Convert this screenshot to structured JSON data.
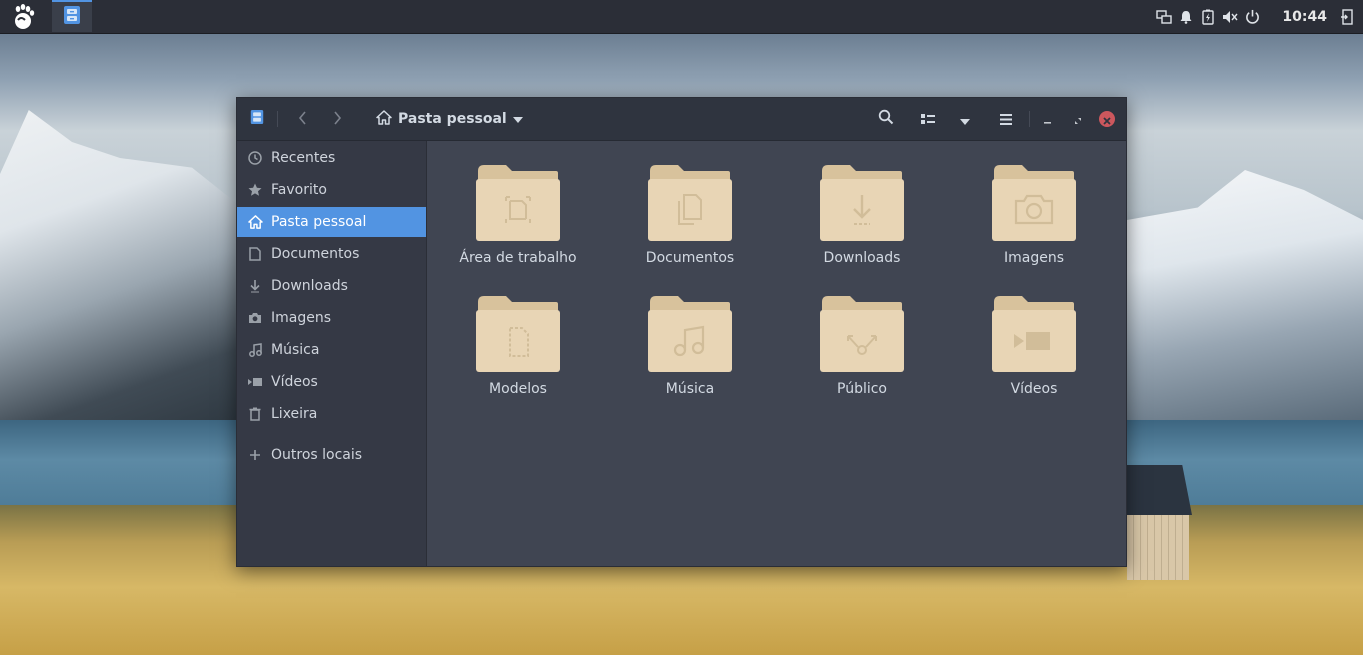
{
  "top_panel": {
    "clock": "10:44",
    "colors": {
      "panel_bg": "#2b2e37",
      "accent": "#5294e2"
    },
    "tray_icons": [
      "network-icon",
      "notifications-bell-icon",
      "battery-icon",
      "volume-muted-icon",
      "power-icon",
      "logout-icon"
    ]
  },
  "window": {
    "path_label": "Pasta pessoal",
    "colors": {
      "header_bg": "#2f343f",
      "sidebar_active": "#5294e2",
      "close": "#cc575d",
      "folder": "#e8d5b5"
    }
  },
  "sidebar": {
    "items": [
      {
        "label": "Recentes",
        "icon": "clock-icon"
      },
      {
        "label": "Favorito",
        "icon": "star-icon"
      },
      {
        "label": "Pasta pessoal",
        "icon": "home-icon",
        "active": true
      },
      {
        "label": "Documentos",
        "icon": "document-icon"
      },
      {
        "label": "Downloads",
        "icon": "download-icon"
      },
      {
        "label": "Imagens",
        "icon": "camera-icon"
      },
      {
        "label": "Música",
        "icon": "music-icon"
      },
      {
        "label": "Vídeos",
        "icon": "video-icon"
      },
      {
        "label": "Lixeira",
        "icon": "trash-icon"
      },
      {
        "label": "Outros locais",
        "icon": "plus-icon"
      }
    ]
  },
  "folders": [
    {
      "label": "Área de trabalho",
      "icon": "desktop-folder-icon"
    },
    {
      "label": "Documentos",
      "icon": "documents-folder-icon"
    },
    {
      "label": "Downloads",
      "icon": "downloads-folder-icon"
    },
    {
      "label": "Imagens",
      "icon": "pictures-folder-icon"
    },
    {
      "label": "Modelos",
      "icon": "templates-folder-icon"
    },
    {
      "label": "Música",
      "icon": "music-folder-icon"
    },
    {
      "label": "Público",
      "icon": "public-folder-icon"
    },
    {
      "label": "Vídeos",
      "icon": "videos-folder-icon"
    }
  ]
}
